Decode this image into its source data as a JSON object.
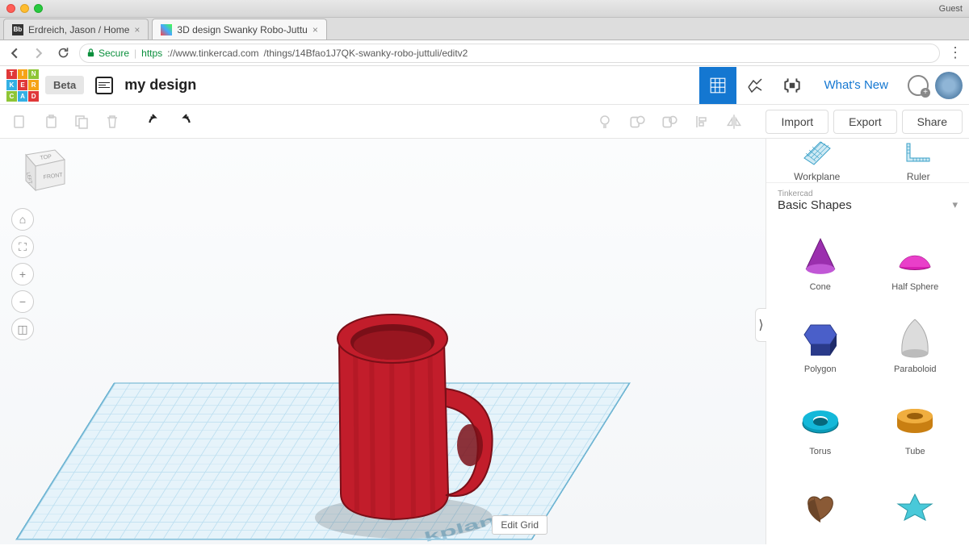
{
  "os": {
    "guest": "Guest"
  },
  "browser": {
    "tabs": [
      {
        "label": "Erdreich, Jason / Home",
        "favicon": "Bb"
      },
      {
        "label": "3D design Swanky Robo-Juttu"
      }
    ],
    "secure_label": "Secure",
    "url_https": "https",
    "url_host": "://www.tinkercad.com",
    "url_path": "/things/14Bfao1J7QK-swanky-robo-juttuli/editv2"
  },
  "appbar": {
    "beta": "Beta",
    "design_name": "my design",
    "whats_new": "What's New"
  },
  "toolbar": {
    "import": "Import",
    "export": "Export",
    "share": "Share"
  },
  "canvas": {
    "viewcube": {
      "top": "TOP",
      "left": "LEFT",
      "front": "FRONT"
    },
    "workplane_label": "kplane",
    "edit_grid": "Edit Grid"
  },
  "panel": {
    "workplane": "Workplane",
    "ruler": "Ruler",
    "brand": "Tinkercad",
    "category": "Basic Shapes",
    "shapes": [
      {
        "name": "Cone"
      },
      {
        "name": "Half Sphere"
      },
      {
        "name": "Polygon"
      },
      {
        "name": "Paraboloid"
      },
      {
        "name": "Torus"
      },
      {
        "name": "Tube"
      },
      {
        "name": ""
      },
      {
        "name": ""
      }
    ]
  }
}
